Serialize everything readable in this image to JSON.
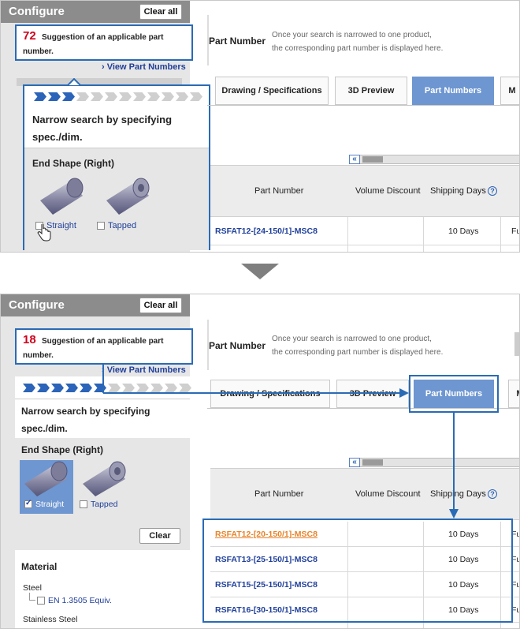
{
  "top": {
    "configure_title": "Configure",
    "clear_all": "Clear all",
    "suggestion_count": "72",
    "suggestion_text": "Suggestion of an applicable part number.",
    "view_part_numbers": "View Part Numbers",
    "narrow_text": "Narrow search by specifying spec./dim.",
    "end_shape_title": "End Shape (Right)",
    "option_straight": "Straight",
    "option_tapped": "Tapped",
    "part_number_title": "Part Number",
    "part_number_note_1": "Once your search is narrowed to one product,",
    "part_number_note_2": "the corresponding part number is displayed here.",
    "tab_drawing": "Drawing / Specifications",
    "tab_3d": "3D Preview",
    "tab_part_numbers": "Part Numbers",
    "tab_more": "M",
    "scroll_left": "«",
    "col_part_number": "Part Number",
    "col_volume_discount": "Volume Discount",
    "col_shipping_days": "Shipping Days",
    "help_mark": "?",
    "rows": [
      {
        "part_number": "RSFAT12-[24-150/1]-MSC8",
        "days": "10 Days",
        "extra": "Fu"
      }
    ]
  },
  "bottom": {
    "configure_title": "Configure",
    "clear_all": "Clear all",
    "suggestion_count": "18",
    "suggestion_text": "Suggestion of an applicable part number.",
    "view_part_numbers": "View Part Numbers",
    "narrow_text": "Narrow search by specifying spec./dim.",
    "end_shape_title": "End Shape (Right)",
    "option_straight": "Straight",
    "option_tapped": "Tapped",
    "clear_button": "Clear",
    "material_title": "Material",
    "material_steel": "Steel",
    "material_steel_sub": "EN 1.3505 Equiv.",
    "material_stainless": "Stainless Steel",
    "part_number_title": "Part Number",
    "part_number_note_1": "Once your search is narrowed to one product,",
    "part_number_note_2": "the corresponding part number is displayed here.",
    "tab_drawing": "Drawing / Specifications",
    "tab_3d": "3D Preview",
    "tab_part_numbers": "Part Numbers",
    "tab_more": "M",
    "scroll_left": "«",
    "col_part_number": "Part Number",
    "col_volume_discount": "Volume Discount",
    "col_shipping_days": "Shipping Days",
    "help_mark": "?",
    "rows": [
      {
        "part_number": "RSFAT12-[20-150/1]-MSC8",
        "days": "10 Days",
        "extra": "Fu"
      },
      {
        "part_number": "RSFAT13-[25-150/1]-MSC8",
        "days": "10 Days",
        "extra": "Fu"
      },
      {
        "part_number": "RSFAT15-[25-150/1]-MSC8",
        "days": "10 Days",
        "extra": "Fu"
      },
      {
        "part_number": "RSFAT16-[30-150/1]-MSC8",
        "days": "10 Days",
        "extra": "Fu"
      }
    ]
  },
  "colors": {
    "highlight_blue": "#2a6bb5",
    "suggestion_red": "#d0021b",
    "active_tab": "#6e96d0",
    "selected_row": "#e8832a",
    "divider_arrow": "#7f7f7f"
  },
  "progress": {
    "top_filled": 3,
    "top_total": 12,
    "bottom_filled": 6,
    "bottom_total": 12
  }
}
